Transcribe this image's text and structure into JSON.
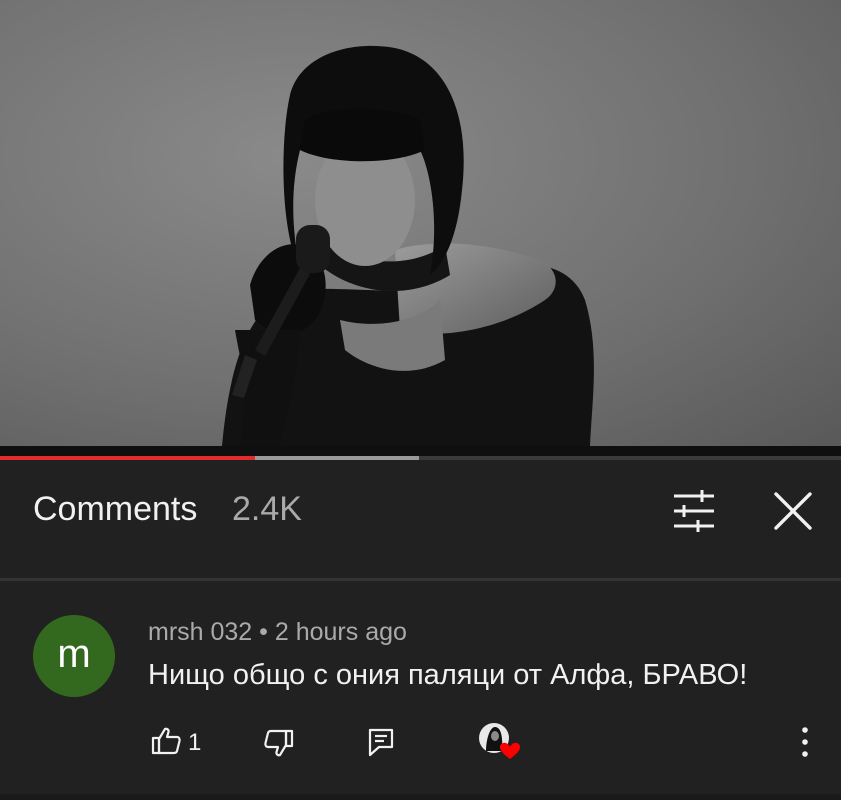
{
  "player": {
    "played_fraction": 0.303,
    "buffered_fraction": 0.498
  },
  "comments_panel": {
    "title": "Comments",
    "count": "2.4K",
    "filter_icon": "filter-sliders-icon",
    "close_icon": "close-icon"
  },
  "comment": {
    "avatar_letter": "m",
    "avatar_color": "#33691e",
    "meta": "mrsh 032 • 2 hours ago",
    "text": "Нищо общо с ония паляци от Алфа, БРАВО!",
    "like_count": "1",
    "icons": [
      "thumb-up-icon",
      "thumb-down-icon",
      "reply-icon",
      "creator-heart-icon",
      "more-vertical-icon"
    ]
  },
  "colors": {
    "background": "#212121",
    "played": "#e22b2b",
    "heart": "#ff0000"
  }
}
